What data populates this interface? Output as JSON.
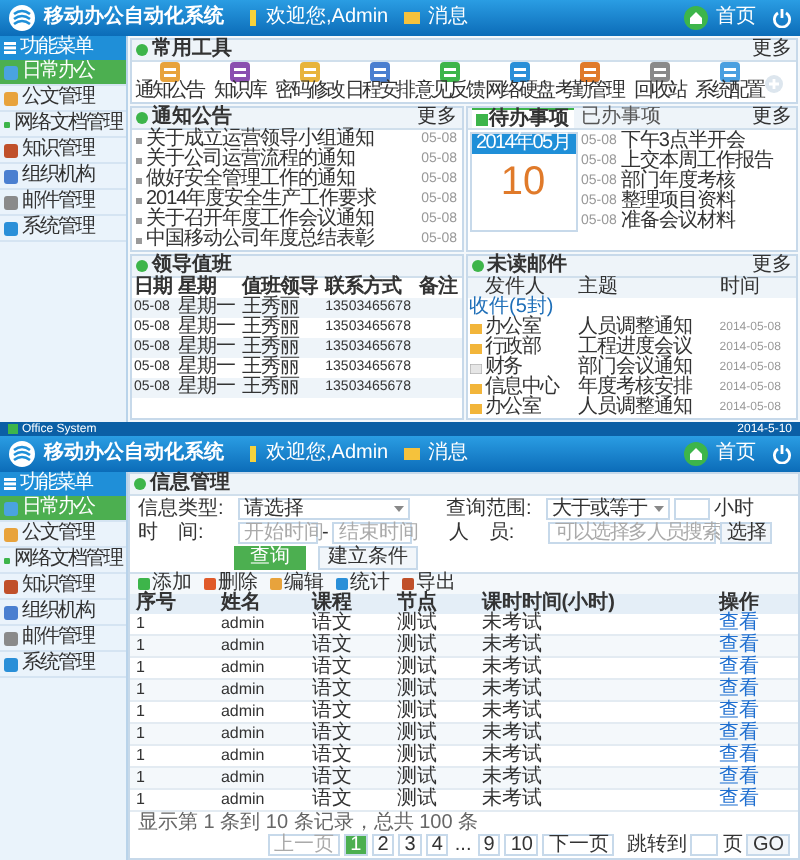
{
  "top_window": {
    "app_title": "移动办公自动化系统",
    "user": "欢迎您,Admin",
    "messages": "消息",
    "home": "首页",
    "sidebar": {
      "title": "功能菜单",
      "items": [
        {
          "label": "日常办公",
          "selected": true
        },
        {
          "label": "公文管理",
          "selected": false
        },
        {
          "label": "网络文档管理",
          "selected": false
        },
        {
          "label": "知识管理",
          "selected": false
        },
        {
          "label": "组织机构",
          "selected": false
        },
        {
          "label": "邮件管理",
          "selected": false
        },
        {
          "label": "系统管理",
          "selected": false
        }
      ]
    },
    "tools": {
      "title": "常用工具",
      "more": "更多",
      "items": [
        "通知公告",
        "知识库",
        "密码修改",
        "日程安排",
        "意见反馈",
        "网络硬盘",
        "考勤管理",
        "回收站",
        "系统配置"
      ]
    },
    "notices": {
      "title": "通知公告",
      "more": "更多",
      "items": [
        {
          "title": "关于成立运营领导小组通知",
          "date": "05-08"
        },
        {
          "title": "关于公司运营流程的通知",
          "date": "05-08"
        },
        {
          "title": "做好安全管理工作的通知",
          "date": "05-08"
        },
        {
          "title": "2014年度安全生产工作要求",
          "date": "05-08"
        },
        {
          "title": "关于召开年度工作会议通知",
          "date": "05-08"
        },
        {
          "title": "中国移动公司年度总结表彰",
          "date": "05-08"
        }
      ]
    },
    "tasks": {
      "tabs": [
        {
          "label": "待办事项",
          "selected": true
        },
        {
          "label": "已办事项",
          "selected": false
        }
      ],
      "more": "更多",
      "calendar_month": "2014年05月",
      "calendar_day": "10",
      "items": [
        {
          "date": "05-08",
          "text": "下午3点半开会"
        },
        {
          "date": "05-08",
          "text": "上交本周工作报告"
        },
        {
          "date": "05-08",
          "text": "部门年度考核"
        },
        {
          "date": "05-08",
          "text": "整理项目资料"
        },
        {
          "date": "05-08",
          "text": "准备会议材料"
        }
      ]
    },
    "duty": {
      "title": "领导值班",
      "columns": [
        "日期",
        "星期",
        "值班领导",
        "联系方式",
        "备注"
      ],
      "rows": [
        [
          "05-08",
          "星期一",
          "王秀丽",
          "13503465678",
          ""
        ],
        [
          "05-08",
          "星期一",
          "王秀丽",
          "13503465678",
          ""
        ],
        [
          "05-08",
          "星期一",
          "王秀丽",
          "13503465678",
          ""
        ],
        [
          "05-08",
          "星期一",
          "王秀丽",
          "13503465678",
          ""
        ],
        [
          "05-08",
          "星期一",
          "王秀丽",
          "13503465678",
          ""
        ]
      ]
    },
    "mail": {
      "title": "未读邮件",
      "more": "更多",
      "columns": [
        "发件人",
        "主题",
        "时间"
      ],
      "group": "收件(5封)",
      "rows": [
        {
          "sender": "办公室",
          "subject": "人员调整通知",
          "time": "2014-05-08",
          "read": false
        },
        {
          "sender": "行政部",
          "subject": "工程进度会议",
          "time": "2014-05-08",
          "read": false
        },
        {
          "sender": "财务",
          "subject": "部门会议通知",
          "time": "2014-05-08",
          "read": true
        },
        {
          "sender": "信息中心",
          "subject": "年度考核安排",
          "time": "2014-05-08",
          "read": false
        },
        {
          "sender": "办公室",
          "subject": "人员调整通知",
          "time": "2014-05-08",
          "read": false
        }
      ]
    }
  },
  "taskbar": {
    "label": "Office System",
    "time": "2014-5-10"
  },
  "bottom_window": {
    "app_title": "移动办公自动化系统",
    "user": "欢迎您,Admin",
    "messages": "消息",
    "home": "首页",
    "sidebar": {
      "title": "功能菜单",
      "items": [
        {
          "label": "日常办公",
          "selected": true
        },
        {
          "label": "公文管理",
          "selected": false
        },
        {
          "label": "网络文档管理",
          "selected": false
        },
        {
          "label": "知识管理",
          "selected": false
        },
        {
          "label": "组织机构",
          "selected": false
        },
        {
          "label": "邮件管理",
          "selected": false
        },
        {
          "label": "系统管理",
          "selected": false
        }
      ]
    },
    "panel_title": "信息管理",
    "form": {
      "type_label": "信息类型:",
      "type_value": "请选择",
      "range_label": "查询范围:",
      "range_value": "大于或等于",
      "range_unit": "小时",
      "time_label": "时　间:",
      "start_placeholder": "开始时间",
      "dash": "-",
      "end_placeholder": "结束时间",
      "person_label": "人　员:",
      "person_placeholder": "可以选择多人员搜索",
      "choose": "选择",
      "search": "查询",
      "reset": "建立条件"
    },
    "toolbar": [
      "添加",
      "删除",
      "编辑",
      "统计",
      "导出"
    ],
    "table": {
      "columns": [
        "序号",
        "姓名",
        "课程",
        "节点",
        "课时时间(小时)",
        "操作"
      ],
      "rows": [
        [
          "1",
          "admin",
          "语文",
          "测试",
          "未考试",
          "查看"
        ],
        [
          "1",
          "admin",
          "语文",
          "测试",
          "未考试",
          "查看"
        ],
        [
          "1",
          "admin",
          "语文",
          "测试",
          "未考试",
          "查看"
        ],
        [
          "1",
          "admin",
          "语文",
          "测试",
          "未考试",
          "查看"
        ],
        [
          "1",
          "admin",
          "语文",
          "测试",
          "未考试",
          "查看"
        ],
        [
          "1",
          "admin",
          "语文",
          "测试",
          "未考试",
          "查看"
        ],
        [
          "1",
          "admin",
          "语文",
          "测试",
          "未考试",
          "查看"
        ],
        [
          "1",
          "admin",
          "语文",
          "测试",
          "未考试",
          "查看"
        ],
        [
          "1",
          "admin",
          "语文",
          "测试",
          "未考试",
          "查看"
        ]
      ]
    },
    "pagination": {
      "summary": "显示第 1 条到 10 条记录，总共 100 条",
      "prev": "上一页",
      "pages": [
        {
          "label": "1",
          "selected": true
        },
        {
          "label": "2",
          "selected": false
        },
        {
          "label": "3",
          "selected": false
        },
        {
          "label": "4",
          "selected": false
        }
      ],
      "ellipsis": "...",
      "tail_pages": [
        "9",
        "10"
      ],
      "next": "下一页",
      "jump_label": "跳转到",
      "page_unit": "页",
      "go": "GO"
    }
  }
}
